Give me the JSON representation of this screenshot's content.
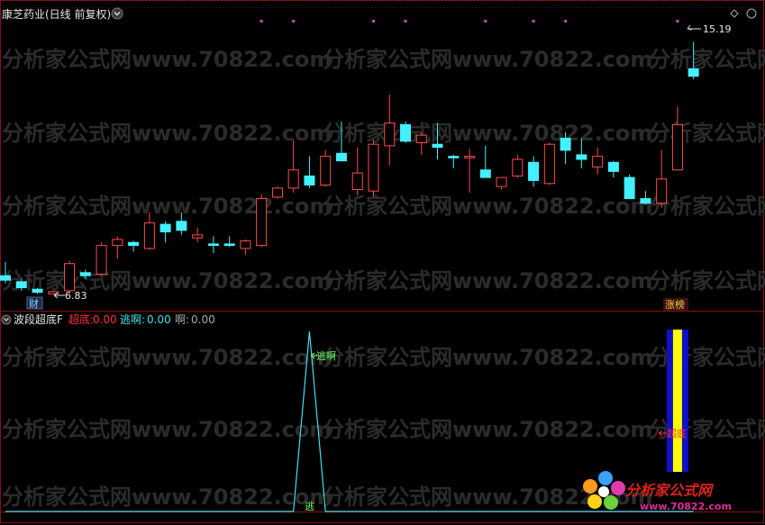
{
  "header": {
    "stock_title": "康芝药业(日线 前复权)",
    "dropdown_icon": "chevron-down-icon"
  },
  "watermark": {
    "text": "分析家公式网www.70822.com"
  },
  "logo": {
    "text": "分析家公式网",
    "url": "www.70822.com"
  },
  "indicator": {
    "name": "波段超底F",
    "items": [
      {
        "label": "超底:",
        "value": "0.00",
        "color": "#ff3030"
      },
      {
        "label": "逃啊:",
        "value": "0.00",
        "color": "#40e0f0"
      },
      {
        "label": "啊:",
        "value": "0.00",
        "color": "#a8a8a8"
      }
    ]
  },
  "annotations": {
    "high_label": "15.19",
    "low_label": "6.83",
    "cai_badge": "财",
    "zhangbang_badge": "涨榜",
    "escape_label": "逃啊",
    "escape_bottom_label": "逃",
    "chaodi_label": "超底"
  },
  "chart_data": [
    {
      "type": "candlestick",
      "title": "康芝药业(日线 前复权)",
      "colors": {
        "up": "#ff4a4a",
        "down": "#44f0ff"
      },
      "ylim": [
        6.5,
        15.8
      ],
      "candles": [
        {
          "o": 7.45,
          "h": 7.9,
          "l": 7.2,
          "c": 7.3
        },
        {
          "o": 7.25,
          "h": 7.35,
          "l": 6.95,
          "c": 7.05
        },
        {
          "o": 7.0,
          "h": 7.05,
          "l": 6.85,
          "c": 6.9
        },
        {
          "o": 6.85,
          "h": 6.95,
          "l": 6.83,
          "c": 6.92
        },
        {
          "o": 6.95,
          "h": 7.95,
          "l": 6.85,
          "c": 7.85
        },
        {
          "o": 7.55,
          "h": 7.65,
          "l": 7.35,
          "c": 7.45
        },
        {
          "o": 7.5,
          "h": 8.55,
          "l": 7.45,
          "c": 8.45
        },
        {
          "o": 8.45,
          "h": 8.75,
          "l": 8.0,
          "c": 8.65
        },
        {
          "o": 8.55,
          "h": 8.6,
          "l": 8.25,
          "c": 8.45
        },
        {
          "o": 8.35,
          "h": 9.55,
          "l": 8.3,
          "c": 9.2
        },
        {
          "o": 9.15,
          "h": 9.25,
          "l": 8.55,
          "c": 8.9
        },
        {
          "o": 9.25,
          "h": 9.55,
          "l": 8.8,
          "c": 8.95
        },
        {
          "o": 8.7,
          "h": 9.05,
          "l": 8.55,
          "c": 8.8
        },
        {
          "o": 8.5,
          "h": 8.75,
          "l": 8.2,
          "c": 8.45
        },
        {
          "o": 8.5,
          "h": 8.75,
          "l": 8.4,
          "c": 8.45
        },
        {
          "o": 8.35,
          "h": 8.65,
          "l": 8.15,
          "c": 8.6
        },
        {
          "o": 8.45,
          "h": 10.15,
          "l": 8.4,
          "c": 10.0
        },
        {
          "o": 10.05,
          "h": 10.4,
          "l": 10.0,
          "c": 10.35
        },
        {
          "o": 10.35,
          "h": 11.95,
          "l": 10.2,
          "c": 10.95
        },
        {
          "o": 10.75,
          "h": 11.4,
          "l": 10.35,
          "c": 10.45
        },
        {
          "o": 10.45,
          "h": 11.6,
          "l": 10.4,
          "c": 11.4
        },
        {
          "o": 11.5,
          "h": 12.55,
          "l": 11.3,
          "c": 11.25
        },
        {
          "o": 10.3,
          "h": 11.7,
          "l": 10.1,
          "c": 10.85
        },
        {
          "o": 10.25,
          "h": 11.95,
          "l": 10.05,
          "c": 11.8
        },
        {
          "o": 11.75,
          "h": 13.45,
          "l": 11.1,
          "c": 12.5
        },
        {
          "o": 12.45,
          "h": 12.55,
          "l": 11.85,
          "c": 11.9
        },
        {
          "o": 11.85,
          "h": 12.2,
          "l": 11.45,
          "c": 12.1
        },
        {
          "o": 11.8,
          "h": 12.5,
          "l": 11.3,
          "c": 11.7
        },
        {
          "o": 11.4,
          "h": 11.45,
          "l": 11.0,
          "c": 11.35
        },
        {
          "o": 11.35,
          "h": 11.65,
          "l": 10.2,
          "c": 11.4
        },
        {
          "o": 10.95,
          "h": 11.75,
          "l": 10.95,
          "c": 10.7
        },
        {
          "o": 10.4,
          "h": 10.65,
          "l": 10.3,
          "c": 10.7
        },
        {
          "o": 10.75,
          "h": 11.45,
          "l": 10.7,
          "c": 11.3
        },
        {
          "o": 11.2,
          "h": 11.4,
          "l": 10.4,
          "c": 10.6
        },
        {
          "o": 10.5,
          "h": 11.85,
          "l": 10.45,
          "c": 11.8
        },
        {
          "o": 12.0,
          "h": 12.2,
          "l": 11.15,
          "c": 11.6
        },
        {
          "o": 11.45,
          "h": 12.0,
          "l": 11.0,
          "c": 11.3
        },
        {
          "o": 11.05,
          "h": 11.7,
          "l": 10.8,
          "c": 11.4
        },
        {
          "o": 11.2,
          "h": 11.25,
          "l": 10.7,
          "c": 10.9
        },
        {
          "o": 10.7,
          "h": 10.8,
          "l": 10.1,
          "c": 10.0
        },
        {
          "o": 10.0,
          "h": 10.25,
          "l": 9.8,
          "c": 9.85
        },
        {
          "o": 9.85,
          "h": 11.6,
          "l": 9.7,
          "c": 10.65
        },
        {
          "o": 10.95,
          "h": 13.05,
          "l": 10.95,
          "c": 12.45
        },
        {
          "o": 14.3,
          "h": 15.19,
          "l": 13.95,
          "c": 14.05
        }
      ]
    },
    {
      "type": "line",
      "title": "波段超底F",
      "series": [
        {
          "name": "逃啊",
          "color": "#40e0f0",
          "values": [
            0,
            0,
            0,
            0,
            0,
            0,
            0,
            0,
            0,
            0,
            0,
            0,
            0,
            0,
            0,
            0,
            0,
            0,
            0,
            100,
            0,
            0,
            0,
            0,
            0,
            0,
            0,
            0,
            0,
            0,
            0,
            0,
            0,
            0,
            0,
            0,
            0,
            0,
            0,
            0,
            0,
            0,
            0,
            0
          ]
        }
      ],
      "bars": [
        {
          "name": "超底",
          "index": 42,
          "colors": [
            "#1010c8",
            "#ffff00"
          ]
        }
      ],
      "ylim": [
        0,
        100
      ]
    }
  ]
}
